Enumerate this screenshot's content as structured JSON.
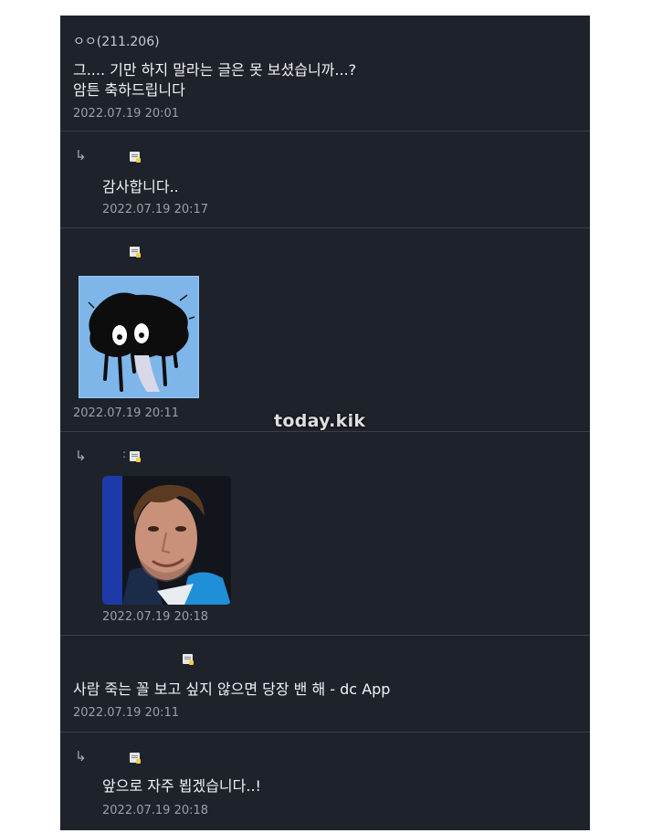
{
  "comments": [
    {
      "author": "ㅇㅇ(211.206)",
      "lines": [
        "그.... 기만 하지 말라는 글은 못 보셨습니까...?",
        "암튼 축하드립니다"
      ],
      "time": "2022.07.19 20:01"
    },
    {
      "reply_arrow": "↳",
      "text": "감사합니다..",
      "time": "2022.07.19 20:17"
    },
    {
      "time": "2022.07.19 20:11",
      "image": "crying-blob-sticker"
    },
    {
      "reply_arrow": "↳",
      "author_suffix": ":",
      "time": "2022.07.19 20:18",
      "image": "smiling-man-photo"
    },
    {
      "text": "사람 죽는 꼴 보고 싶지 않으면 당장 밴 해 - dc App",
      "time": "2022.07.19 20:11"
    },
    {
      "reply_arrow": "↳",
      "text": "앞으로 자주 뵙겠습니다..!",
      "time": "2022.07.19 20:18"
    }
  ],
  "watermark": "today.kik",
  "colors": {
    "background": "#1e222a",
    "divider": "#3a3f48",
    "text": "#f1f2f4",
    "meta": "#9aa0a8",
    "sticker_bg": "#7fb6ea"
  }
}
